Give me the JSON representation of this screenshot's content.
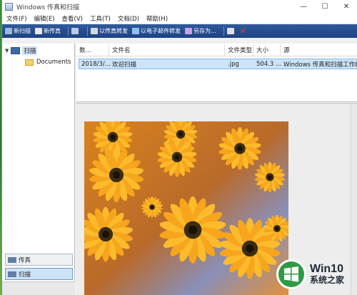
{
  "window": {
    "title": "Windows 传真和扫描",
    "buttons": {
      "minimize": "—",
      "maximize": "☐",
      "close": "✕"
    }
  },
  "menu": [
    "文件(F)",
    "编辑(E)",
    "查看(V)",
    "工具(T)",
    "文档(D)",
    "帮助(H)"
  ],
  "toolbar": {
    "new_scan": "新扫描",
    "new_fax": "新传真",
    "forward_fax": "以传真转发",
    "forward_email": "以电子邮件转发",
    "save_as": "另存为..."
  },
  "tree": {
    "root": "扫描",
    "child": "Documents"
  },
  "nav": {
    "fax": "传真",
    "scan": "扫描"
  },
  "list": {
    "columns": [
      "数...",
      "文件名",
      "文件类型",
      "大小",
      "源"
    ],
    "rows": [
      {
        "date": "2018/3/...",
        "name": "欢迎扫描",
        "type": ".jpg",
        "size": "504.3 ...",
        "source": "Windows 传真和扫描工作组"
      }
    ]
  },
  "watermark": {
    "brand": "Win10",
    "site": "系统之家"
  },
  "colors": {
    "toolbar": "#1d4383",
    "selection": "#cce4fa",
    "flower_orange": "#f29a12",
    "flower_center": "#3b2d12"
  }
}
